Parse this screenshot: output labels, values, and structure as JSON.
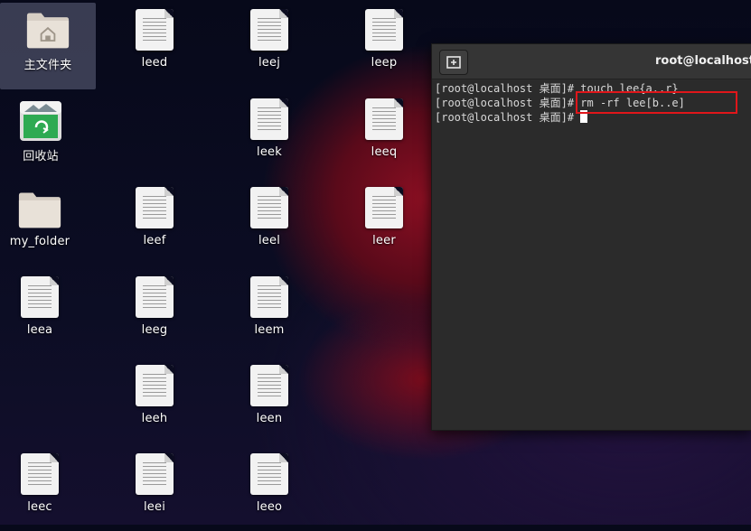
{
  "desktop": {
    "icons": [
      {
        "label": "主文件夹",
        "type": "home"
      },
      {
        "label": "回收站",
        "type": "trash"
      },
      {
        "label": "my_folder",
        "type": "folder"
      },
      {
        "label": "leea",
        "type": "file"
      },
      {
        "label": "leec",
        "type": "file"
      },
      {
        "label": "leed",
        "type": "file"
      },
      {
        "label": "leef",
        "type": "file"
      },
      {
        "label": "leeg",
        "type": "file"
      },
      {
        "label": "leeh",
        "type": "file"
      },
      {
        "label": "leei",
        "type": "file"
      },
      {
        "label": "leej",
        "type": "file"
      },
      {
        "label": "leek",
        "type": "file"
      },
      {
        "label": "leel",
        "type": "file"
      },
      {
        "label": "leem",
        "type": "file"
      },
      {
        "label": "leen",
        "type": "file"
      },
      {
        "label": "leeo",
        "type": "file"
      },
      {
        "label": "leep",
        "type": "file"
      },
      {
        "label": "leeq",
        "type": "file"
      },
      {
        "label": "leer",
        "type": "file"
      }
    ]
  },
  "terminal": {
    "title": "root@localhost",
    "lines": [
      "[root@localhost 桌面]# touch lee{a..r}",
      "[root@localhost 桌面]# rm -rf lee[b..e]",
      "[root@localhost 桌面]# "
    ]
  },
  "colors": {
    "highlight": "#e0161a",
    "terminal_bg": "#2b2b2b",
    "terminal_header": "#353535"
  }
}
